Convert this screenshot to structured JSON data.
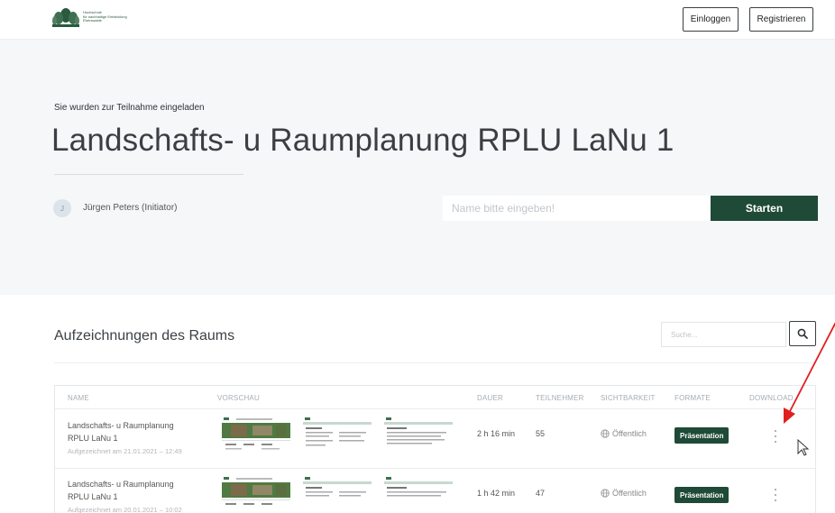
{
  "header": {
    "logo_lines": [
      "Hochschule",
      "für nachhaltige Entwicklung",
      "Eberswalde"
    ],
    "login_label": "Einloggen",
    "register_label": "Registrieren"
  },
  "hero": {
    "invite_text": "Sie wurden zur Teilnahme eingeladen",
    "room_title": "Landschafts- u Raumplanung RPLU LaNu 1",
    "owner_initial": "J",
    "owner_name": "Jürgen Peters (Initiator)",
    "name_placeholder": "Name bitte eingeben!",
    "start_label": "Starten"
  },
  "recordings": {
    "title": "Aufzeichnungen des Raums",
    "search_placeholder": "Suche...",
    "columns": [
      "NAME",
      "VORSCHAU",
      "DAUER",
      "TEILNEHMER",
      "SICHTBARKEIT",
      "FORMATE",
      "DOWNLOAD"
    ],
    "rows": [
      {
        "name_line1": "Landschafts- u Raumplanung",
        "name_line2": "RPLU LaNu 1",
        "recorded": "Aufgezeichnet am 21.01.2021 – 12:49",
        "duration": "2 h 16 min",
        "participants": "55",
        "visibility": "Öffentlich",
        "format": "Präsentation"
      },
      {
        "name_line1": "Landschafts- u Raumplanung",
        "name_line2": "RPLU LaNu 1",
        "recorded": "Aufgezeichnet am 20.01.2021 – 10:02",
        "duration": "1 h 42 min",
        "participants": "47",
        "visibility": "Öffentlich",
        "format": "Präsentation"
      }
    ]
  },
  "colors": {
    "brand_green": "#1f4a37",
    "hero_background": "#f5f7f9",
    "annotation_arrow": "#e02020"
  },
  "icons": {
    "search": "magnifier-icon",
    "visibility": "globe-icon",
    "download": "vertical-ellipsis-icon",
    "cursor": "mouse-pointer-icon",
    "annotation": "red-arrow-icon"
  }
}
